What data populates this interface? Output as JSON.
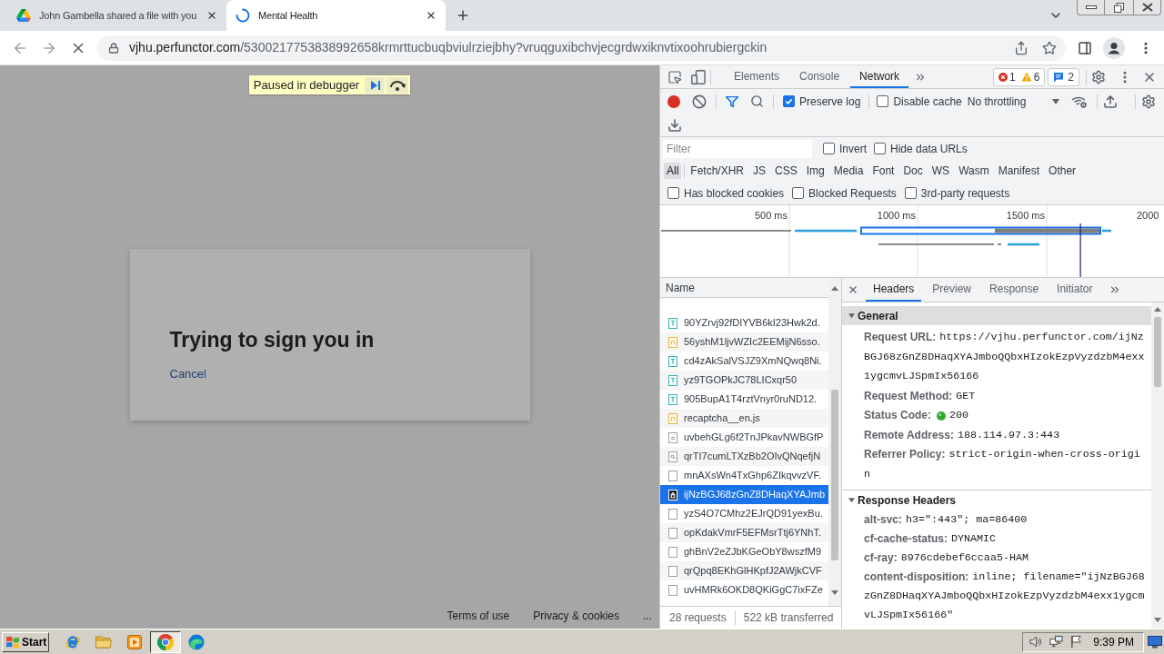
{
  "browser": {
    "tabs": [
      {
        "title": "John Gambella shared a file with you",
        "kind": "drive",
        "selected": false
      },
      {
        "title": "Mental Health",
        "kind": "loading",
        "selected": true
      }
    ],
    "address": {
      "host": "vjhu.perfunctor.com",
      "path": "/5300217753838992658krmrttucbuqbviulrziejbhy?vruqguxibchvjecgrdwxiknvtixoohrubiergckin"
    }
  },
  "page": {
    "debugger_banner": "Paused in debugger",
    "dialog": {
      "title": "Trying to sign you in",
      "link": "Cancel"
    },
    "footer_links": [
      "Terms of use",
      "Privacy & cookies",
      "..."
    ]
  },
  "devtools": {
    "tabs": [
      {
        "label": "Elements",
        "selected": false
      },
      {
        "label": "Console",
        "selected": false
      },
      {
        "label": "Network",
        "selected": true
      }
    ],
    "issues": {
      "errors": "1",
      "warnings": "6",
      "messages": "2"
    },
    "toolbar": {
      "recording": true,
      "options": [
        {
          "label": "Preserve log",
          "checked": true
        },
        {
          "label": "Disable cache",
          "checked": false
        }
      ],
      "throttling": "No throttling"
    },
    "filter": {
      "placeholder": "Filter",
      "options": [
        {
          "label": "Invert",
          "checked": false
        },
        {
          "label": "Hide data URLs",
          "checked": false
        }
      ]
    },
    "types": [
      {
        "label": "All",
        "selected": true
      },
      {
        "label": "Fetch/XHR",
        "selected": false
      },
      {
        "label": "JS",
        "selected": false
      },
      {
        "label": "CSS",
        "selected": false
      },
      {
        "label": "Img",
        "selected": false
      },
      {
        "label": "Media",
        "selected": false
      },
      {
        "label": "Font",
        "selected": false
      },
      {
        "label": "Doc",
        "selected": false
      },
      {
        "label": "WS",
        "selected": false
      },
      {
        "label": "Wasm",
        "selected": false
      },
      {
        "label": "Manifest",
        "selected": false
      },
      {
        "label": "Other",
        "selected": false
      }
    ],
    "blocked_options": [
      {
        "label": "Has blocked cookies",
        "checked": false
      },
      {
        "label": "Blocked Requests",
        "checked": false
      },
      {
        "label": "3rd-party requests",
        "checked": false
      }
    ],
    "timeline": {
      "ticks": [
        "500 ms",
        "1000 ms",
        "1500 ms",
        "2000"
      ]
    },
    "requests": {
      "column": "Name",
      "rows": [
        {
          "name": "90YZrvj92fDIYVB6kI23Hwk2d.",
          "kind": "text",
          "selected": false
        },
        {
          "name": "56yshM1ljvWZIc2EEMijN6sso.",
          "kind": "script",
          "selected": false
        },
        {
          "name": "cd4zAkSalVSJZ9XmNQwq8Ni.",
          "kind": "text",
          "selected": false
        },
        {
          "name": "yz9TGOPkJC78LICxqr50",
          "kind": "text",
          "selected": false
        },
        {
          "name": "905BupA1T4rztVnyr0ruND12.",
          "kind": "text",
          "selected": false
        },
        {
          "name": "recaptcha__en.js",
          "kind": "script",
          "selected": false
        },
        {
          "name": "uvbehGLg6f2TnJPkavNWBGfP",
          "kind": "document",
          "selected": false
        },
        {
          "name": "qrTI7cumLTXzBb2OIvQNqefjN",
          "kind": "image",
          "selected": false
        },
        {
          "name": "mnAXsWn4TxGhp6ZIkqvvzVF.",
          "kind": "other",
          "selected": false
        },
        {
          "name": "ijNzBGJ68zGnZ8DHaqXYAJmb",
          "kind": "other",
          "selected": true
        },
        {
          "name": "yzS4O7CMhz2EJrQD91yexBu.",
          "kind": "other",
          "selected": false
        },
        {
          "name": "opKdakVmrF5EFMsrTtj6YNhT.",
          "kind": "other",
          "selected": false
        },
        {
          "name": "ghBnV2eZJbKGeObY8wszfM9",
          "kind": "other",
          "selected": false
        },
        {
          "name": "qrQpq8EKhGlHKpfJ2AWjkCVF",
          "kind": "other",
          "selected": false
        },
        {
          "name": "uvHMRk6OKD8QKiGgC7ixFZe",
          "kind": "other",
          "selected": false
        }
      ],
      "summary": [
        "28 requests",
        "522 kB transferred"
      ]
    },
    "details": {
      "tabs": [
        {
          "label": "Headers",
          "selected": true
        },
        {
          "label": "Preview",
          "selected": false
        },
        {
          "label": "Response",
          "selected": false
        },
        {
          "label": "Initiator",
          "selected": false
        }
      ],
      "sections": [
        {
          "title": "General",
          "expanded": true,
          "focused": true,
          "rows": [
            {
              "name": "Request URL:",
              "value": "https://vjhu.perfunctor.com/ijNzBGJ68zGnZ8DHaqXYAJmboQQbxHIzokEzpVyzdzbM4exx1ygcmvLJSpmIx56166",
              "kind": "text"
            },
            {
              "name": "Request Method:",
              "value": "GET",
              "kind": "text"
            },
            {
              "name": "Status Code:",
              "value": "200",
              "kind": "status"
            },
            {
              "name": "Remote Address:",
              "value": "188.114.97.3:443",
              "kind": "text"
            },
            {
              "name": "Referrer Policy:",
              "value": "strict-origin-when-cross-origin",
              "kind": "text"
            }
          ]
        },
        {
          "title": "Response Headers",
          "expanded": true,
          "focused": false,
          "rows": [
            {
              "name": "alt-svc:",
              "value": "h3=\":443\"; ma=86400",
              "kind": "text"
            },
            {
              "name": "cf-cache-status:",
              "value": "DYNAMIC",
              "kind": "text"
            },
            {
              "name": "cf-ray:",
              "value": "8976cdebef6ccaa5-HAM",
              "kind": "text"
            },
            {
              "name": "content-disposition:",
              "value": "inline; filename=\"ijNzBGJ68zGnZ8DHaqXYAJmboQQbxHIzokEzpVyzdzbM4exx1ygcmvLJSpmIx56166\"",
              "kind": "text"
            }
          ]
        }
      ]
    }
  },
  "taskbar": {
    "start": "Start",
    "apps": [
      {
        "kind": "ie",
        "active": false
      },
      {
        "kind": "folder",
        "active": false
      },
      {
        "kind": "media",
        "active": false
      },
      {
        "kind": "chrome",
        "active": true
      },
      {
        "kind": "edge",
        "active": false
      }
    ],
    "clock": "9:39 PM"
  }
}
